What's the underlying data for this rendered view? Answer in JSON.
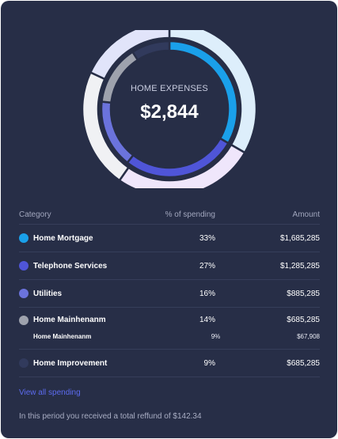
{
  "donut": {
    "label": "HOME EXPENSES",
    "value": "$2,844"
  },
  "colors": {
    "mortgage": "#1aa0ea",
    "telephone": "#4f55d8",
    "utilities": "#6b73dc",
    "mainhenanm": "#9ea2ad",
    "improvement": "#313a5c",
    "outer_blue": "#ddeefb",
    "outer_purple": "#efe6fb",
    "outer_gray": "#f0f1f4",
    "outer_lavender": "#e1e4fa"
  },
  "chart_data": {
    "type": "pie",
    "title": "HOME EXPENSES",
    "categories": [
      "Home Mortgage",
      "Telephone Services",
      "Utilities",
      "Home Mainhenanm",
      "Home Improvement"
    ],
    "values": [
      33,
      27,
      16,
      14,
      9
    ]
  },
  "table": {
    "headers": {
      "category": "Category",
      "percent": "% of spending",
      "amount": "Amount"
    },
    "rows": [
      {
        "category": "Home Mortgage",
        "percent": "33%",
        "amount": "$1,685,285",
        "color": "#1aa0ea"
      },
      {
        "category": "Telephone Services",
        "percent": "27%",
        "amount": "$1,285,285",
        "color": "#4f55d8"
      },
      {
        "category": "Utilities",
        "percent": "16%",
        "amount": "$885,285",
        "color": "#6b73dc"
      },
      {
        "category": "Home Mainhenanm",
        "percent": "14%",
        "amount": "$685,285",
        "color": "#9ea2ad",
        "sub": {
          "category": "Home Mainhenanm",
          "percent": "9%",
          "amount": "$67,908"
        }
      },
      {
        "category": "Home Improvement",
        "percent": "9%",
        "amount": "$685,285",
        "color": "#313a5c"
      }
    ]
  },
  "footer": {
    "link": "View all spending",
    "note": "In this period you received a total reffund of $142.34"
  }
}
